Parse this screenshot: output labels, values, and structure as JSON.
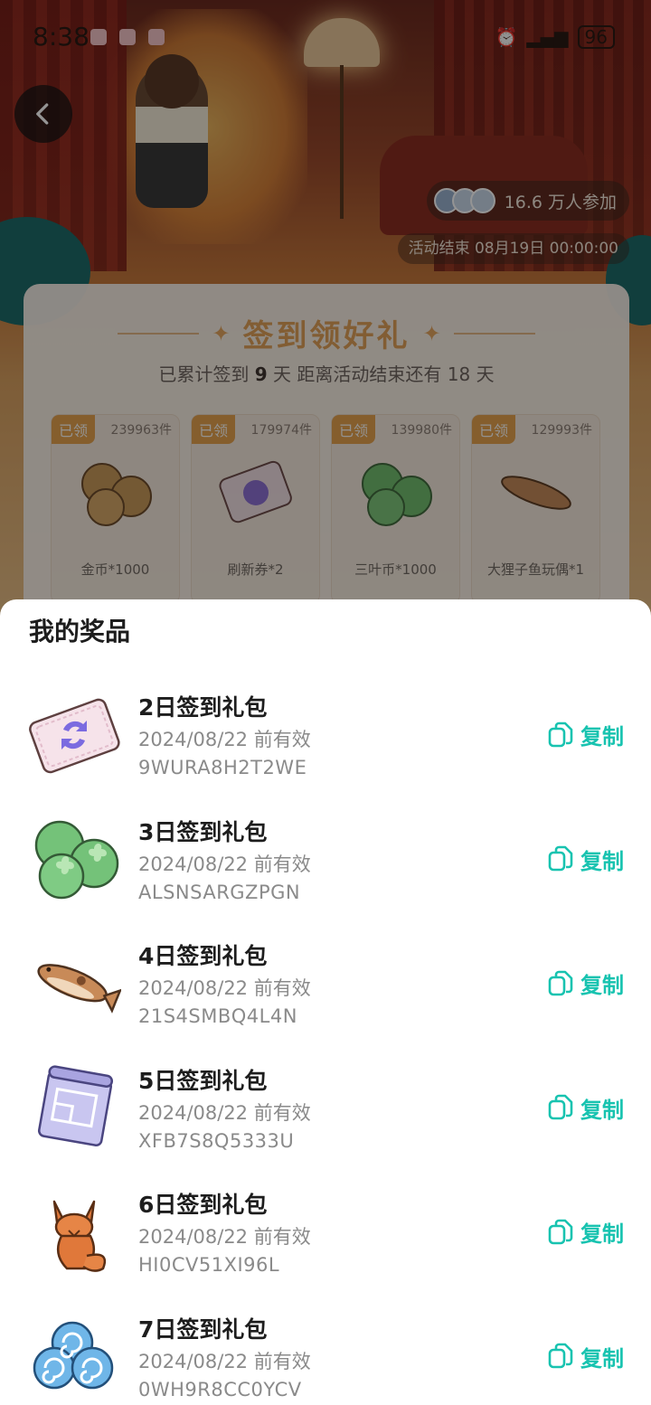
{
  "status_bar": {
    "time": "8:38",
    "battery": "96"
  },
  "activity": {
    "participants": "16.6 万人参加",
    "end_time": "活动结束 08月19日 00:00:00",
    "signin_title": "签到领好礼",
    "signin_prefix": "已累计签到",
    "signin_days": "9",
    "signin_mid": "天  距离活动结束还有",
    "remaining_days": "18",
    "signin_suffix": "天",
    "rewards": [
      {
        "badge": "已领",
        "count": "239963件",
        "name": "金币*1000",
        "icon": "coin-icon"
      },
      {
        "badge": "已领",
        "count": "179974件",
        "name": "刷新券*2",
        "icon": "refresh-ticket-icon"
      },
      {
        "badge": "已领",
        "count": "139980件",
        "name": "三叶币*1000",
        "icon": "clover-coin-icon"
      },
      {
        "badge": "已领",
        "count": "129993件",
        "name": "大狸子鱼玩偶*1",
        "icon": "fish-plush-icon"
      }
    ]
  },
  "sheet": {
    "title": "我的奖品",
    "copy_label": "复制",
    "prizes": [
      {
        "name": "2日签到礼包",
        "valid": "2024/08/22 前有效",
        "code": "9WURA8H2T2WE",
        "icon": "refresh-ticket-icon"
      },
      {
        "name": "3日签到礼包",
        "valid": "2024/08/22 前有效",
        "code": "ALSNSARGZPGN",
        "icon": "clover-coin-icon"
      },
      {
        "name": "4日签到礼包",
        "valid": "2024/08/22 前有效",
        "code": "21S4SMBQ4L4N",
        "icon": "fish-plush-icon"
      },
      {
        "name": "5日签到礼包",
        "valid": "2024/08/22 前有效",
        "code": "XFB7S8Q5333U",
        "icon": "blueprint-scroll-icon"
      },
      {
        "name": "6日签到礼包",
        "valid": "2024/08/22 前有效",
        "code": "HI0CV51XI96L",
        "icon": "fox-statue-icon"
      },
      {
        "name": "7日签到礼包",
        "valid": "2024/08/22 前有效",
        "code": "0WH9R8CC0YCV",
        "icon": "blue-swirl-icon"
      }
    ]
  },
  "colors": {
    "accent": "#18c3b0",
    "gold": "#e2a15a",
    "badge": "#e6a34e"
  }
}
